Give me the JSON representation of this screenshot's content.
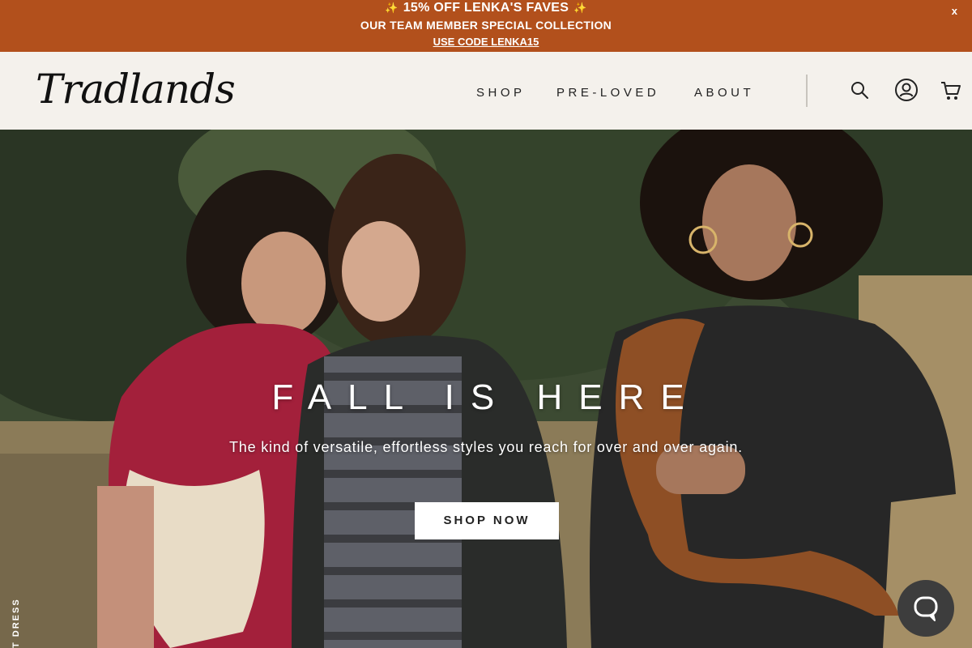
{
  "promo": {
    "line1": "15% OFF LENKA'S FAVES",
    "spark_left": "✨",
    "spark_right": "✨",
    "line2": "OUR TEAM MEMBER SPECIAL COLLECTION",
    "code_link": "USE CODE LENKA15",
    "close_label": "x",
    "background": "#b2501c"
  },
  "header": {
    "logo_text": "Tradlands",
    "nav": [
      "SHOP",
      "PRE-LOVED",
      "ABOUT"
    ],
    "icons": [
      "search-icon",
      "account-icon",
      "cart-icon"
    ]
  },
  "hero": {
    "title": "FALL IS HERE",
    "subtitle": "The kind of versatile, effortless styles you reach for over and over again.",
    "cta": "SHOP NOW",
    "side_tag": "T DRESS"
  },
  "chat": {
    "icon": "chat-bubble-icon"
  }
}
